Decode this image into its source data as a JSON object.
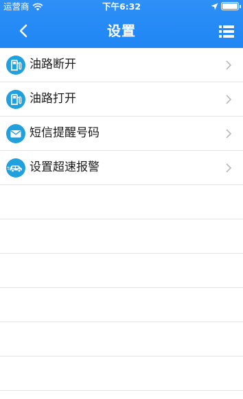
{
  "status_bar": {
    "carrier": "运营商",
    "time": "下午6:32",
    "icons": [
      "wifi-icon",
      "location-arrow-icon",
      "battery-icon"
    ]
  },
  "nav": {
    "title": "设置",
    "left_icon": "back-chevron-icon",
    "right_icon": "list-menu-icon"
  },
  "menu": [
    {
      "label": "油路断开",
      "icon": "fuel-pump-icon"
    },
    {
      "label": "油路打开",
      "icon": "fuel-pump-icon"
    },
    {
      "label": "短信提醒号码",
      "icon": "envelope-icon"
    },
    {
      "label": "设置超速报警",
      "icon": "car-speed-icon"
    }
  ],
  "colors": {
    "header_blue": "#1f86f4",
    "icon_blue": "#21a0de",
    "divider": "#e3e3e3"
  }
}
